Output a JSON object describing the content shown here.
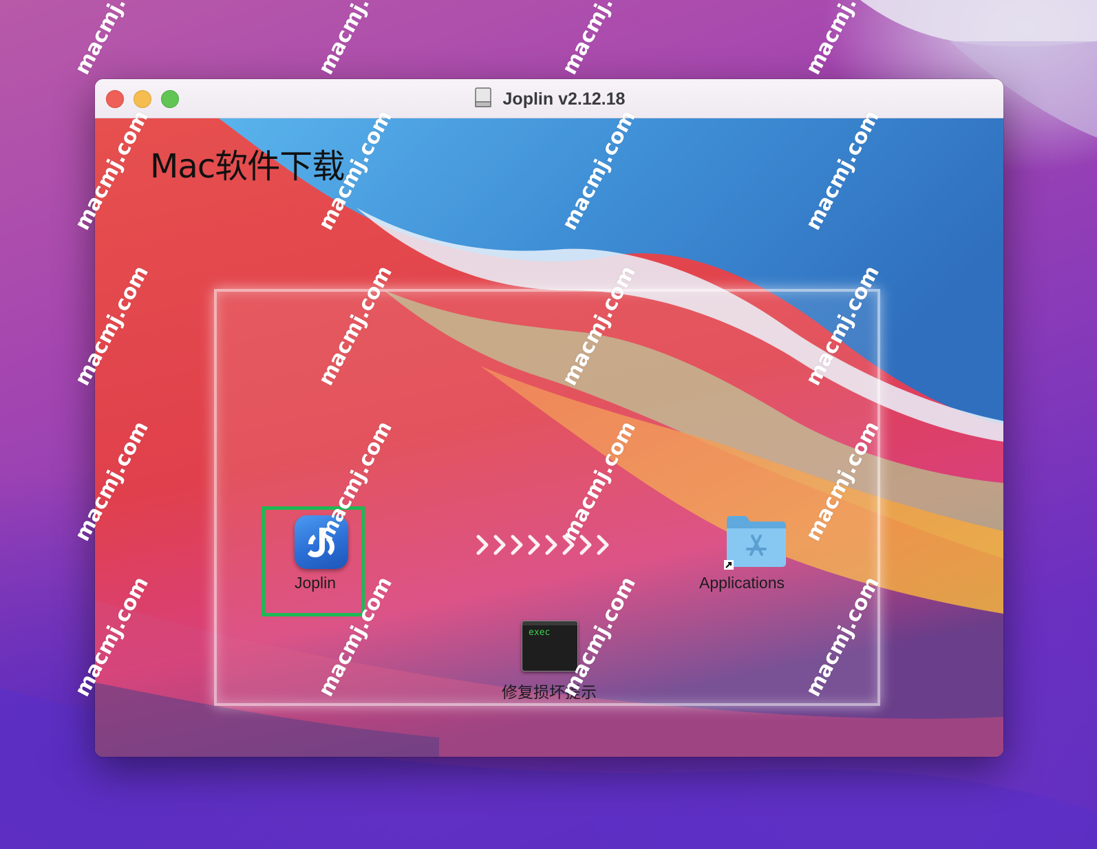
{
  "window": {
    "title": "Joplin v2.12.18",
    "traffic_lights": [
      "close",
      "minimize",
      "zoom"
    ]
  },
  "content": {
    "heading": "Mac软件下载",
    "items": {
      "app": {
        "label": "Joplin",
        "icon": "joplin-app-icon",
        "selected": true
      },
      "applications": {
        "label": "Applications",
        "icon": "applications-folder-icon"
      },
      "exec": {
        "label": "修复损坏提示",
        "icon_text": "exec"
      }
    },
    "arrow_glyphs": ">>>>>>>>"
  },
  "watermark": {
    "text": "macmj.com"
  },
  "colors": {
    "selection": "#1db954",
    "folder": "#7cc3ee",
    "exec_text": "#3fd14e"
  }
}
